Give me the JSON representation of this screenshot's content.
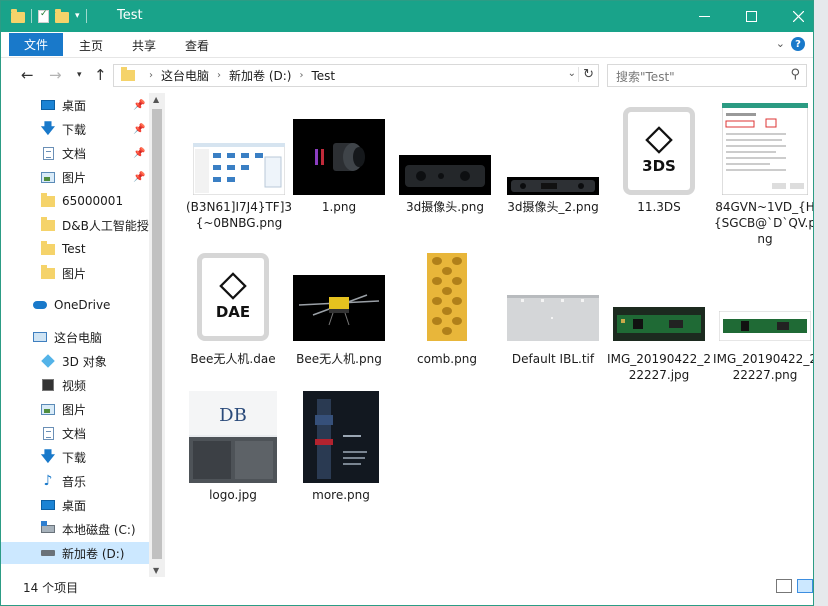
{
  "window": {
    "title": "Test"
  },
  "ribbon": {
    "tabs": [
      {
        "label": "文件"
      },
      {
        "label": "主页"
      },
      {
        "label": "共享"
      },
      {
        "label": "查看"
      }
    ]
  },
  "address": {
    "crumbs": [
      "这台电脑",
      "新加卷 (D:)",
      "Test"
    ]
  },
  "search": {
    "placeholder": "搜索\"Test\""
  },
  "sidebar": {
    "quick_access": [
      {
        "label": "桌面",
        "icon": "desktop-icon",
        "pinned": true
      },
      {
        "label": "下载",
        "icon": "download-icon",
        "pinned": true
      },
      {
        "label": "文档",
        "icon": "document-icon",
        "pinned": true
      },
      {
        "label": "图片",
        "icon": "picture-icon",
        "pinned": true
      },
      {
        "label": "65000001",
        "icon": "folder-icon"
      },
      {
        "label": "D&B人工智能授",
        "icon": "folder-icon"
      },
      {
        "label": "Test",
        "icon": "folder-icon"
      },
      {
        "label": "图片",
        "icon": "folder-icon"
      }
    ],
    "onedrive": {
      "label": "OneDrive",
      "icon": "cloud-icon"
    },
    "this_pc": {
      "label": "这台电脑",
      "icon": "computer-icon"
    },
    "pc_items": [
      {
        "label": "3D 对象",
        "icon": "3d-objects-icon"
      },
      {
        "label": "视频",
        "icon": "video-icon"
      },
      {
        "label": "图片",
        "icon": "picture-icon"
      },
      {
        "label": "文档",
        "icon": "document-icon"
      },
      {
        "label": "下载",
        "icon": "download-icon"
      },
      {
        "label": "音乐",
        "icon": "music-icon"
      },
      {
        "label": "桌面",
        "icon": "desktop-icon"
      },
      {
        "label": "本地磁盘 (C:)",
        "icon": "local-disk-icon"
      },
      {
        "label": "新加卷 (D:)",
        "icon": "drive-icon",
        "selected": true
      }
    ]
  },
  "files": [
    {
      "name": "(B3N61]I7J4}TF]3{~0BNBG.png",
      "kind": "screenshot"
    },
    {
      "name": "1.png",
      "kind": "lens"
    },
    {
      "name": "3d摄像头.png",
      "kind": "camera"
    },
    {
      "name": "3d摄像头_2.png",
      "kind": "camera2"
    },
    {
      "name": "11.3DS",
      "kind": "3d-file",
      "ext": "3DS"
    },
    {
      "name": "84GVN~1VD_{H{SGCB@`D`QV.png",
      "kind": "dialog"
    },
    {
      "name": "Bee无人机.dae",
      "kind": "3d-file",
      "ext": "DAE"
    },
    {
      "name": "Bee无人机.png",
      "kind": "drone"
    },
    {
      "name": "comb.png",
      "kind": "comb"
    },
    {
      "name": "Default IBL.tif",
      "kind": "ibl"
    },
    {
      "name": "IMG_20190422_222227.jpg",
      "kind": "pcb"
    },
    {
      "name": "IMG_20190422_222227.png",
      "kind": "pcb2"
    },
    {
      "name": "logo.jpg",
      "kind": "logo"
    },
    {
      "name": "more.png",
      "kind": "more"
    }
  ],
  "status": {
    "count": "14 个项目"
  },
  "colors": {
    "title_bar": "#19a38a",
    "file_tab": "#1979ca",
    "selection": "#cce8ff"
  }
}
